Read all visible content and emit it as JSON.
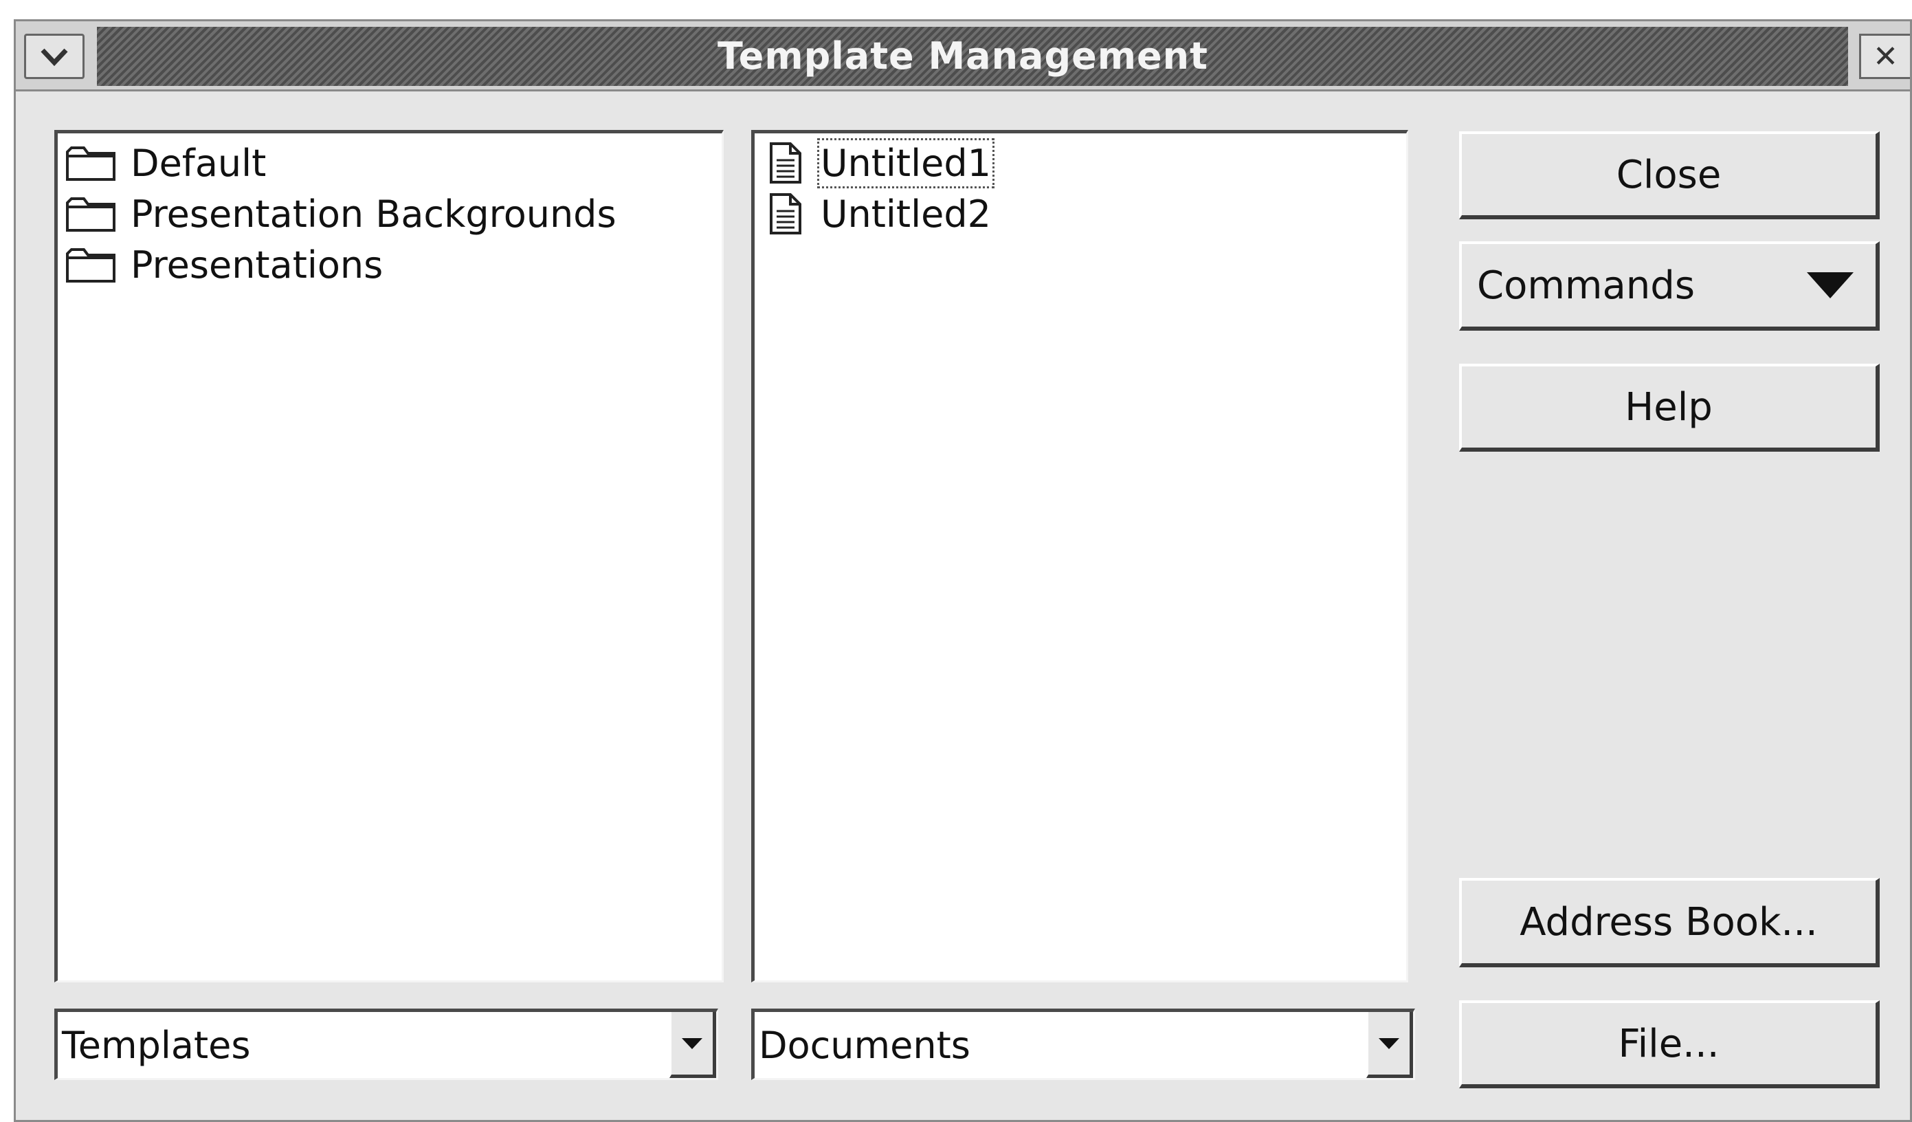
{
  "window": {
    "title": "Template Management"
  },
  "categories": [
    {
      "label": "Default",
      "icon": "folder-icon"
    },
    {
      "label": "Presentation Backgrounds",
      "icon": "folder-icon"
    },
    {
      "label": "Presentations",
      "icon": "folder-icon"
    }
  ],
  "documents": [
    {
      "label": "Untitled1",
      "icon": "document-icon",
      "focused": true
    },
    {
      "label": "Untitled2",
      "icon": "document-icon",
      "focused": false
    }
  ],
  "left_combo": {
    "value": "Templates"
  },
  "right_combo": {
    "value": "Documents"
  },
  "buttons": {
    "close": "Close",
    "commands": "Commands",
    "help": "Help",
    "address_book": "Address Book...",
    "file": "File..."
  }
}
